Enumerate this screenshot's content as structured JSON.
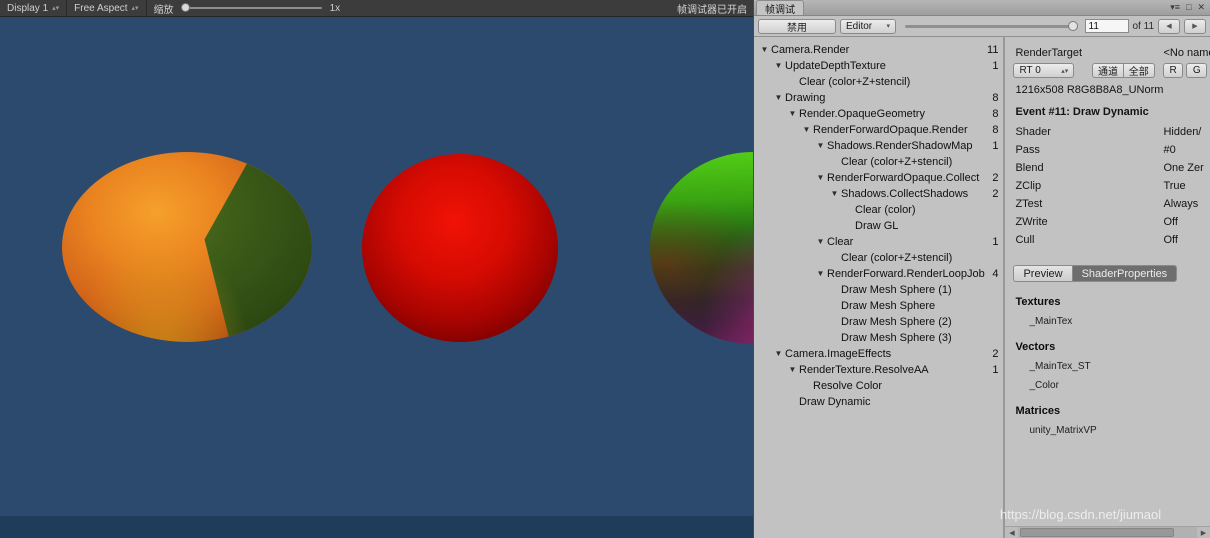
{
  "colors": {
    "game_background": "#2b4a6e",
    "game_bottom_bar": "#1f3c5b",
    "toolbar_background": "#3c3c3c",
    "panel_background": "#c2c2c2",
    "selected_tab_background": "#6e6e6e"
  },
  "game_view": {
    "toolbar": {
      "display_popup": "Display 1",
      "aspect_popup": "Free Aspect",
      "zoom_label": "缩放",
      "zoom_value": "1x",
      "status": "帧调试器已开启"
    }
  },
  "frame_debugger": {
    "window_title": "帧调试",
    "toolbar": {
      "disable_button": "禁用",
      "editor_dropdown": "Editor",
      "event_current": "11",
      "event_total": "of 11"
    },
    "tree": [
      {
        "indent": 0,
        "arrow": true,
        "label": "Camera.Render",
        "count": "11"
      },
      {
        "indent": 1,
        "arrow": true,
        "label": "UpdateDepthTexture",
        "count": "1"
      },
      {
        "indent": 2,
        "arrow": false,
        "label": "Clear (color+Z+stencil)",
        "count": ""
      },
      {
        "indent": 1,
        "arrow": true,
        "label": "Drawing",
        "count": "8"
      },
      {
        "indent": 2,
        "arrow": true,
        "label": "Render.OpaqueGeometry",
        "count": "8"
      },
      {
        "indent": 3,
        "arrow": true,
        "label": "RenderForwardOpaque.Render",
        "count": "8"
      },
      {
        "indent": 4,
        "arrow": true,
        "label": "Shadows.RenderShadowMap",
        "count": "1"
      },
      {
        "indent": 5,
        "arrow": false,
        "label": "Clear (color+Z+stencil)",
        "count": ""
      },
      {
        "indent": 4,
        "arrow": true,
        "label": "RenderForwardOpaque.Collect",
        "count": "2"
      },
      {
        "indent": 5,
        "arrow": true,
        "label": "Shadows.CollectShadows",
        "count": "2"
      },
      {
        "indent": 6,
        "arrow": false,
        "label": "Clear (color)",
        "count": ""
      },
      {
        "indent": 6,
        "arrow": false,
        "label": "Draw GL",
        "count": ""
      },
      {
        "indent": 4,
        "arrow": true,
        "label": "Clear",
        "count": "1"
      },
      {
        "indent": 5,
        "arrow": false,
        "label": "Clear (color+Z+stencil)",
        "count": ""
      },
      {
        "indent": 4,
        "arrow": true,
        "label": "RenderForward.RenderLoopJob",
        "count": "4"
      },
      {
        "indent": 5,
        "arrow": false,
        "label": "Draw Mesh Sphere (1)",
        "count": ""
      },
      {
        "indent": 5,
        "arrow": false,
        "label": "Draw Mesh Sphere",
        "count": ""
      },
      {
        "indent": 5,
        "arrow": false,
        "label": "Draw Mesh Sphere (2)",
        "count": ""
      },
      {
        "indent": 5,
        "arrow": false,
        "label": "Draw Mesh Sphere (3)",
        "count": ""
      },
      {
        "indent": 1,
        "arrow": true,
        "label": "Camera.ImageEffects",
        "count": "2"
      },
      {
        "indent": 2,
        "arrow": true,
        "label": "RenderTexture.ResolveAA",
        "count": "1"
      },
      {
        "indent": 3,
        "arrow": false,
        "label": "Resolve Color",
        "count": ""
      },
      {
        "indent": 2,
        "arrow": false,
        "label": "Draw Dynamic",
        "count": ""
      }
    ],
    "details": {
      "render_target_label": "RenderTarget",
      "render_target_value": "<No name",
      "rt_dropdown": "RT 0",
      "channel_button": "通道",
      "all_button": "全部",
      "r_button": "R",
      "g_button": "G",
      "size_info": "1216x508 R8G8B8A8_UNorm",
      "event_title": "Event #11: Draw Dynamic",
      "properties": [
        {
          "label": "Shader",
          "value": "Hidden/"
        },
        {
          "label": "Pass",
          "value": "#0"
        },
        {
          "label": "Blend",
          "value": "One Zer"
        },
        {
          "label": "ZClip",
          "value": "True"
        },
        {
          "label": "ZTest",
          "value": "Always"
        },
        {
          "label": "ZWrite",
          "value": "Off"
        },
        {
          "label": "Cull",
          "value": "Off"
        }
      ],
      "tabs": [
        {
          "label": "Preview",
          "selected": false
        },
        {
          "label": "ShaderProperties",
          "selected": true
        }
      ],
      "sections": [
        {
          "title": "Textures",
          "items": [
            "_MainTex"
          ]
        },
        {
          "title": "Vectors",
          "items": [
            "_MainTex_ST",
            "_Color"
          ]
        },
        {
          "title": "Matrices",
          "items": [
            "unity_MatrixVP"
          ]
        }
      ]
    }
  },
  "watermark": "https://blog.csdn.net/jiumaol"
}
